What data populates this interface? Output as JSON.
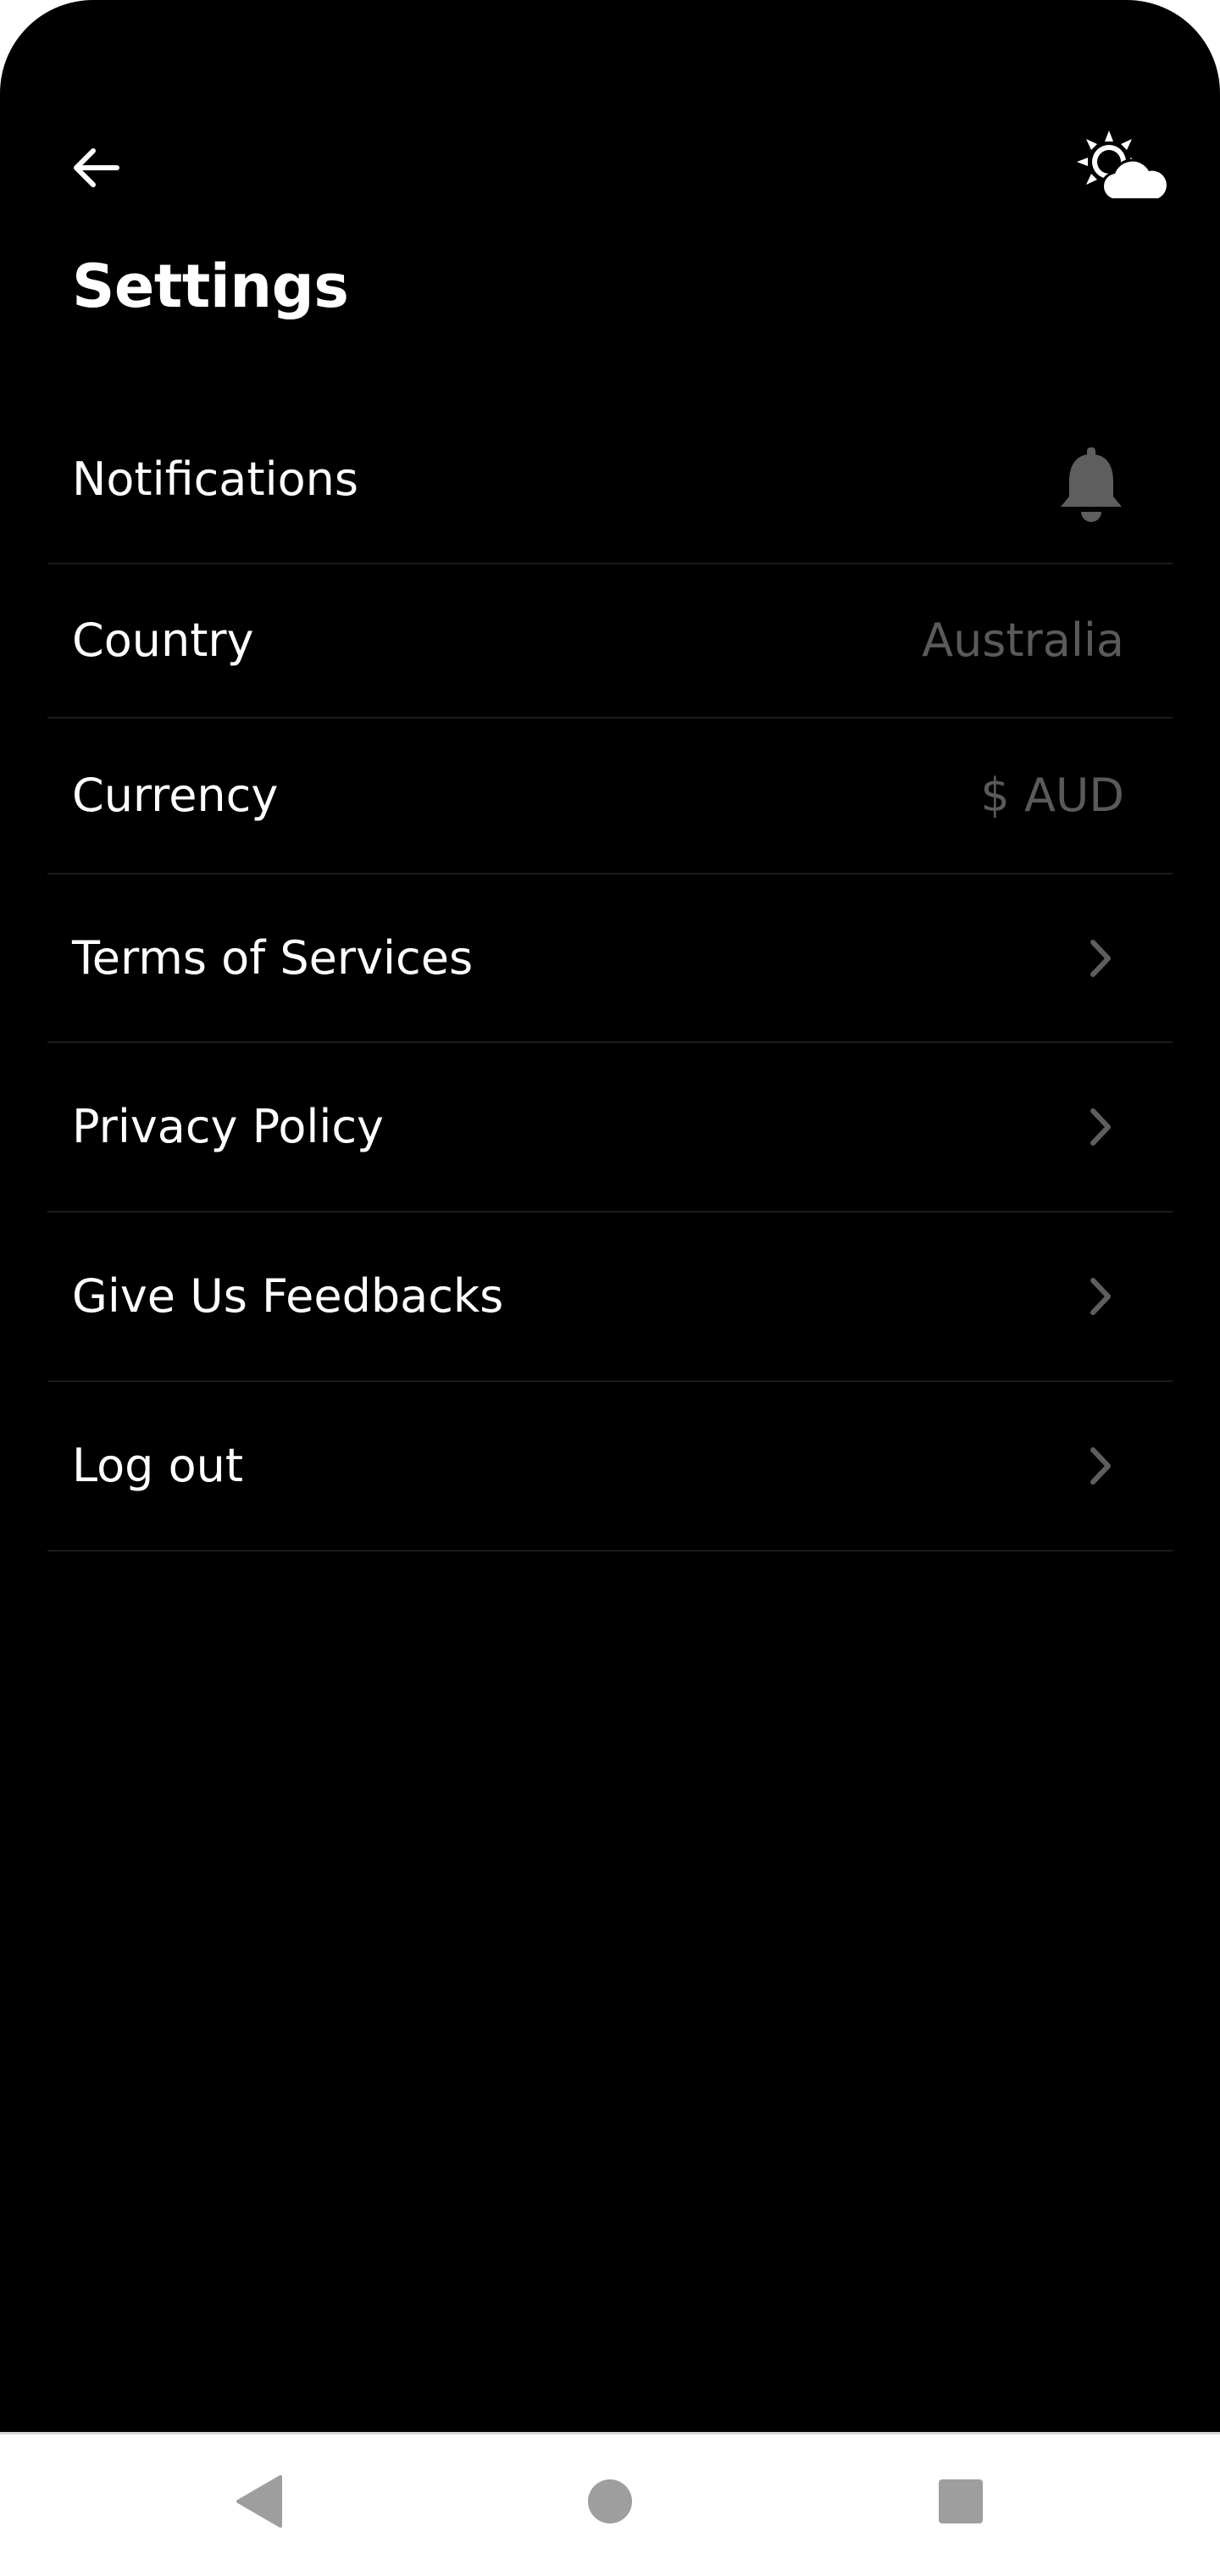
{
  "header": {
    "title": "Settings",
    "back_icon": "arrow-left-icon",
    "theme_icon": "sun-cloud-icon"
  },
  "settings": {
    "items": [
      {
        "label": "Notifications",
        "value": "",
        "icon": "bell-icon"
      },
      {
        "label": "Country",
        "value": "Australia",
        "icon": ""
      },
      {
        "label": "Currency",
        "value": "$ AUD",
        "icon": ""
      },
      {
        "label": "Terms of Services",
        "value": "",
        "icon": "chevron-right-icon"
      },
      {
        "label": "Privacy Policy",
        "value": "",
        "icon": "chevron-right-icon"
      },
      {
        "label": "Give Us Feedbacks",
        "value": "",
        "icon": "chevron-right-icon"
      },
      {
        "label": "Log out",
        "value": "",
        "icon": "chevron-right-icon"
      }
    ]
  },
  "navigation_bar": {
    "back_icon": "nav-back-triangle-icon",
    "home_icon": "nav-home-circle-icon",
    "recents_icon": "nav-recents-square-icon"
  },
  "colors": {
    "background": "#000000",
    "text_primary": "#ffffff",
    "text_secondary": "#5a5a5a",
    "divider": "#1c1c1c",
    "icon_muted": "#5e5e5e",
    "nav_bar_background": "#ffffff",
    "nav_icon": "#9e9e9e"
  }
}
